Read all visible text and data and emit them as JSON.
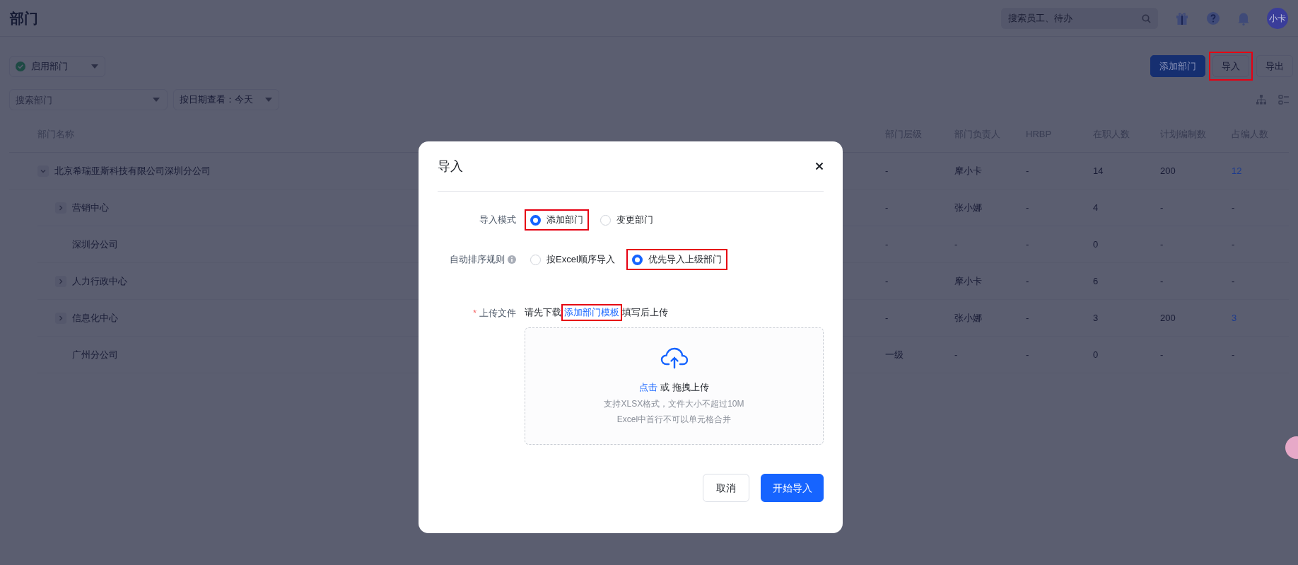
{
  "header": {
    "title": "部门",
    "search": {
      "placeholder": "搜索员工、待办"
    },
    "avatar": "小卡"
  },
  "toolbar": {
    "status_filter": "启用部门",
    "buttons": [
      {
        "label": "添加部门",
        "kind": "primary",
        "highlighted": false
      },
      {
        "label": "导入",
        "kind": "default",
        "highlighted": true
      },
      {
        "label": "导出",
        "kind": "default",
        "highlighted": false
      }
    ],
    "search": {
      "placeholder": "搜索部门"
    },
    "date_filter": "按日期查看：今天"
  },
  "table": {
    "columns": [
      "部门名称",
      "部门层级",
      "部门负责人",
      "HRBP",
      "在职人数",
      "计划编制数",
      "占编人数"
    ],
    "rows": [
      {
        "cells": [
          "北京希瑞亚斯科技有限公司深圳分公司",
          "-",
          "摩小卡",
          "-",
          "14",
          "200",
          "12"
        ],
        "expanded": true,
        "occupied_link": true,
        "children": [
          {
            "cells": [
              "营销中心",
              "-",
              "张小娜",
              "-",
              "4",
              "-",
              "-"
            ],
            "expanded": false,
            "occupied_link": false
          },
          {
            "cells": [
              "深圳分公司",
              "-",
              "-",
              "-",
              "0",
              "-",
              "-"
            ],
            "occupied_link": false
          },
          {
            "cells": [
              "人力行政中心",
              "-",
              "摩小卡",
              "-",
              "6",
              "-",
              "-"
            ],
            "expanded": false,
            "occupied_link": false
          },
          {
            "cells": [
              "信息化中心",
              "-",
              "张小娜",
              "-",
              "3",
              "200",
              "3"
            ],
            "expanded": false,
            "occupied_link": true
          },
          {
            "cells": [
              "广州分公司",
              "一级",
              "-",
              "-",
              "0",
              "-",
              "-"
            ],
            "occupied_link": false
          }
        ]
      }
    ]
  },
  "dialog": {
    "title": "导入",
    "fields": [
      {
        "label": "导入模式",
        "info": false,
        "options": [
          {
            "label": "添加部门",
            "selected": true,
            "highlighted": true
          },
          {
            "label": "变更部门",
            "selected": false,
            "highlighted": false
          }
        ]
      },
      {
        "label": "自动排序规则",
        "info": true,
        "options": [
          {
            "label": "按Excel顺序导入",
            "selected": false,
            "highlighted": false
          },
          {
            "label": "优先导入上级部门",
            "selected": true,
            "highlighted": true
          }
        ]
      }
    ],
    "upload": {
      "label": "上传文件",
      "required_mark": "*",
      "before": "请先下载",
      "link": "添加部门模板",
      "link_highlighted": true,
      "after": "填写后上传",
      "click": "点击",
      "drag": "或 拖拽上传",
      "hints": [
        "支持XLSX格式，文件大小不超过10M",
        "Excel中首行不可以单元格合并"
      ]
    },
    "buttons": [
      {
        "label": "取消",
        "kind": "default"
      },
      {
        "label": "开始导入",
        "kind": "primary"
      }
    ]
  }
}
